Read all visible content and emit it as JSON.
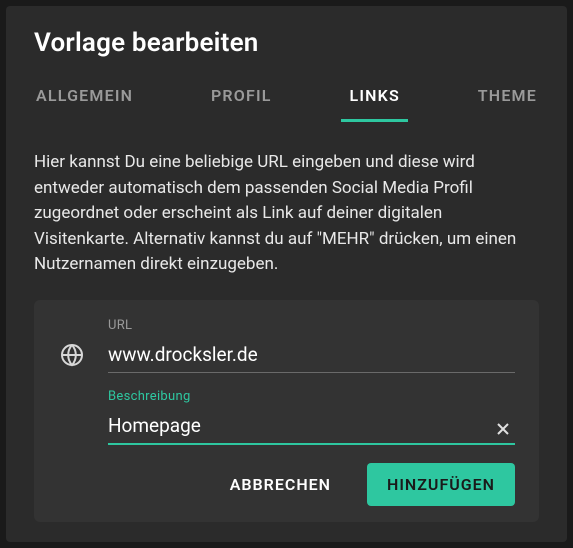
{
  "dialog": {
    "title": "Vorlage bearbeiten",
    "tabs": [
      {
        "label": "ALLGEMEIN",
        "active": false
      },
      {
        "label": "PROFIL",
        "active": false
      },
      {
        "label": "LINKS",
        "active": true
      },
      {
        "label": "THEME",
        "active": false
      }
    ],
    "description": "Hier kannst Du eine beliebige URL eingeben und diese wird entweder automatisch dem passenden Social Media Profil zugeordnet oder erscheint als Link auf deiner digitalen Visitenkarte. Alternativ kannst du auf \"MEHR\" drücken, um einen Nutzernamen direkt einzugeben."
  },
  "form": {
    "url": {
      "label": "URL",
      "value": "www.drocksler.de",
      "icon": "globe-icon"
    },
    "description_field": {
      "label": "Beschreibung",
      "value": "Homepage",
      "focused": true,
      "clear_icon": "close-icon"
    }
  },
  "actions": {
    "cancel": "ABBRECHEN",
    "add": "HINZUFÜGEN"
  },
  "colors": {
    "accent": "#2ec7a0",
    "bg_dialog": "#2b2b2b",
    "bg_card": "#333333"
  }
}
